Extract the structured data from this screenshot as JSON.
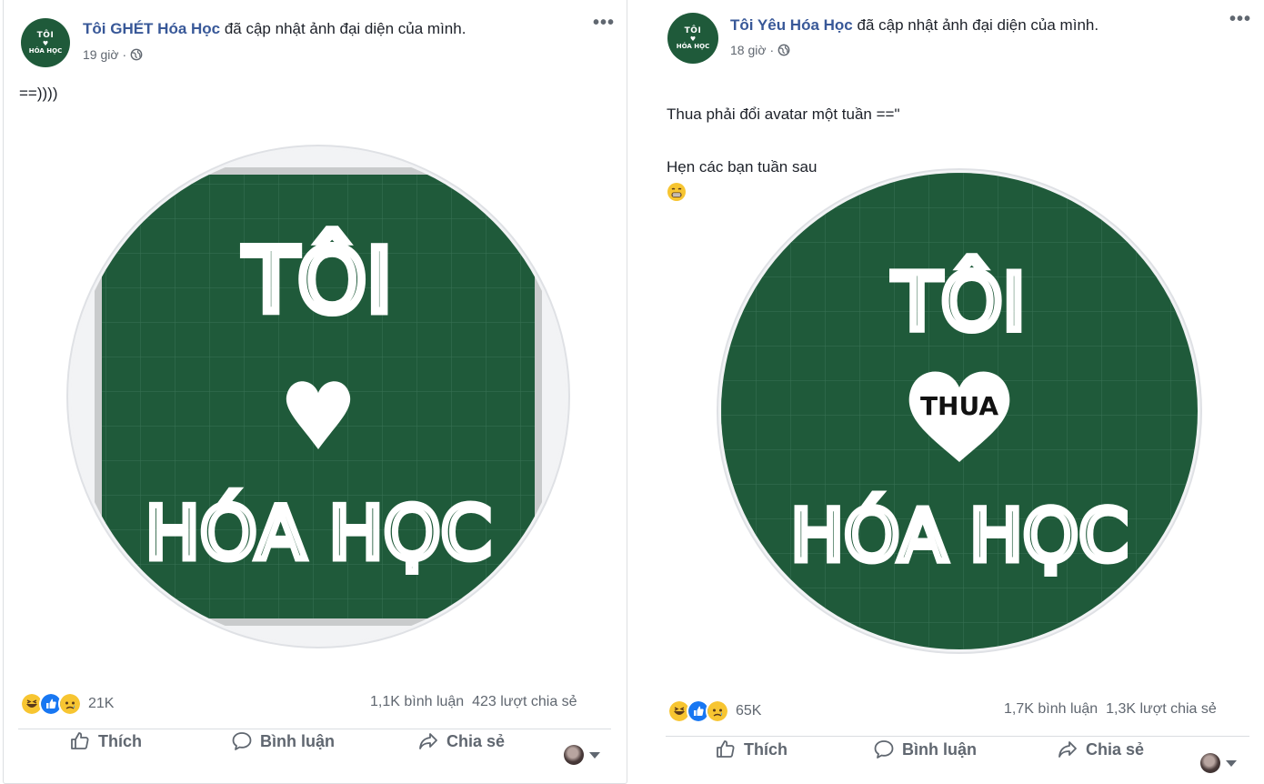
{
  "posts": [
    {
      "avatar": {
        "line1": "TÔI",
        "line2": "♥",
        "line3": "HÓA HỌC"
      },
      "page_name": "Tôi GHÉT Hóa Học",
      "action_text": " đã cập nhật ảnh đại diện của mình.",
      "time": "19 giờ",
      "privacy_icon": "globe-icon",
      "more_label": "•••",
      "caption": "==))))",
      "photo": {
        "line1": "TÔI",
        "line3": "HÓA HỌC",
        "bg": "#1f5a3a"
      },
      "reactions": [
        "haha",
        "like",
        "sad"
      ],
      "reaction_count": "21K",
      "comments": "1,1K bình luận",
      "shares": "423 lượt chia sẻ",
      "actions": {
        "like": "Thích",
        "comment": "Bình luận",
        "share": "Chia sẻ"
      }
    },
    {
      "avatar": {
        "line1": "TÔI",
        "line2": "♥",
        "line3": "HÓA HỌC"
      },
      "page_name": "Tôi Yêu Hóa Học",
      "action_text": " đã cập nhật ảnh đại diện của mình.",
      "time": "18 giờ",
      "privacy_icon": "globe-icon",
      "more_label": "•••",
      "caption_line1": "Thua phải đổi avatar một tuần ==\"",
      "caption_line2": "Hẹn các bạn tuần sau",
      "photo": {
        "line1": "TÔI",
        "heart_text": "THUA",
        "line3": "HÓA HỌC",
        "bg": "#1f5a3a"
      },
      "reactions": [
        "haha",
        "like",
        "sad"
      ],
      "reaction_count": "65K",
      "comments": "1,7K bình luận",
      "shares": "1,3K lượt chia sẻ",
      "actions": {
        "like": "Thích",
        "comment": "Bình luận",
        "share": "Chia sẻ"
      }
    }
  ],
  "colors": {
    "page_link": "#385898",
    "chalkboard": "#1f5a3a",
    "like_blue": "#1877f2",
    "haha_yellow": "#f7c531"
  }
}
